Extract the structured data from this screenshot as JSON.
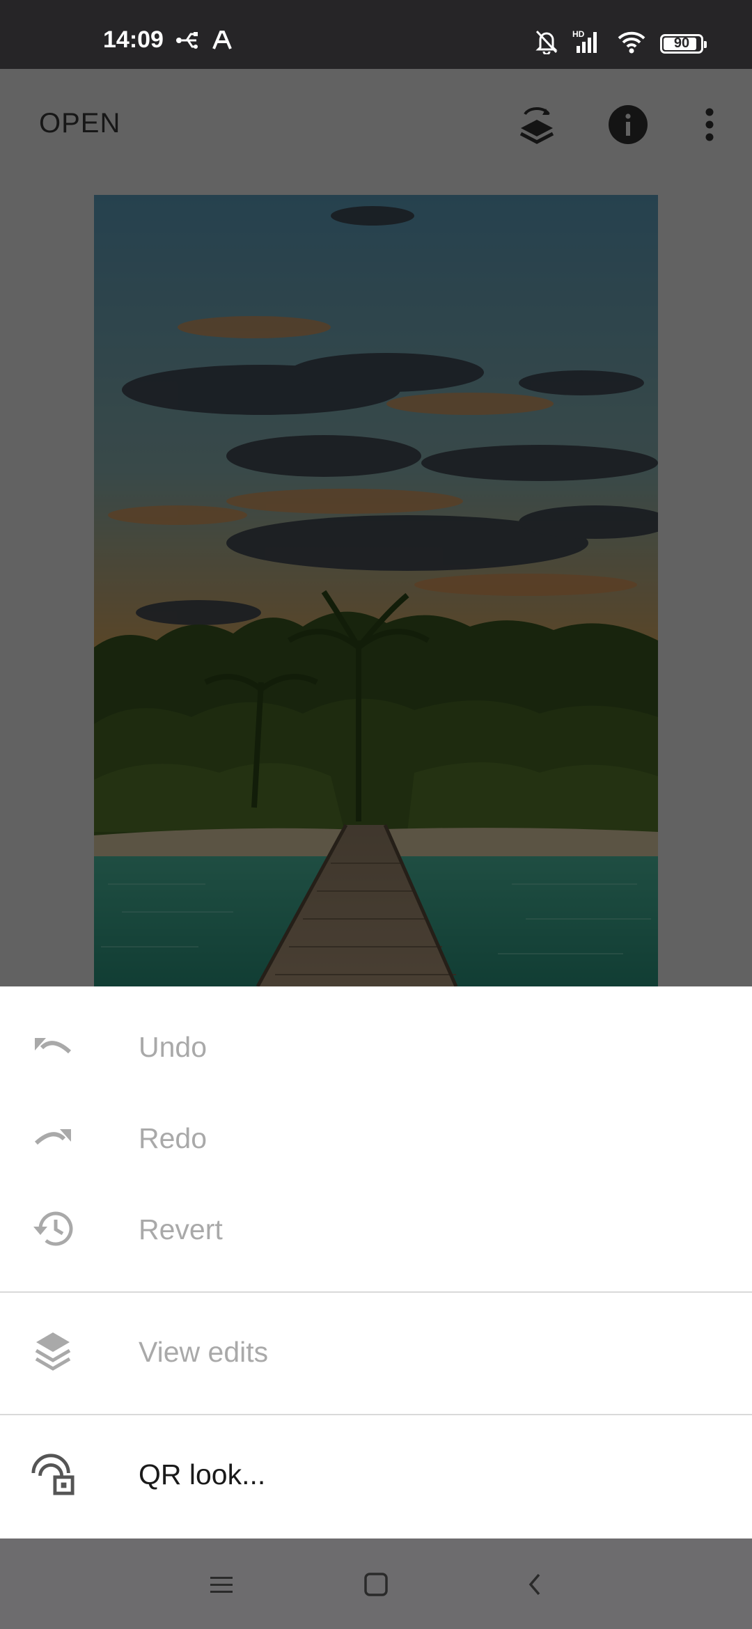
{
  "status_bar": {
    "time": "14:09",
    "battery_level": "90",
    "network_label": "HD",
    "icons": [
      "usb-debug-icon",
      "font-a-icon",
      "silent-bell-icon",
      "signal-icon",
      "wifi-icon",
      "battery-icon"
    ]
  },
  "toolbar": {
    "open_label": "OPEN",
    "icons": [
      "layers-swap-icon",
      "info-icon",
      "more-vert-icon"
    ]
  },
  "photo": {
    "description_icon": "beach-pier-photo"
  },
  "menu": {
    "items": [
      {
        "label": "Undo",
        "icon": "undo-icon",
        "enabled": false
      },
      {
        "label": "Redo",
        "icon": "redo-icon",
        "enabled": false
      },
      {
        "label": "Revert",
        "icon": "history-icon",
        "enabled": false
      },
      {
        "label": "View edits",
        "icon": "layers-icon",
        "enabled": false
      },
      {
        "label": "QR look...",
        "icon": "qr-look-icon",
        "enabled": true
      }
    ]
  },
  "nav_bar": {
    "icons": [
      "menu-icon",
      "home-icon",
      "back-icon"
    ]
  },
  "colors": {
    "status_bar_bg": "#262527",
    "nav_bar_bg": "#6d6c6e",
    "disabled_text": "#a9a9a9",
    "enabled_text": "#1a1a1a",
    "divider": "#d9d9d9"
  }
}
